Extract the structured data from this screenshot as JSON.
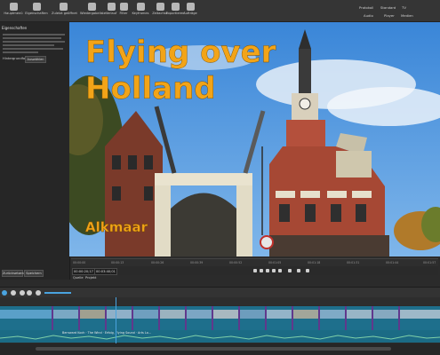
{
  "toolbar": {
    "items": [
      {
        "label": "Hauptmenü",
        "icon": "menu-icon"
      },
      {
        "label": "Eigenschaften",
        "icon": "properties-icon"
      },
      {
        "label": "Zuletzt geöffnet",
        "icon": "recent-icon"
      },
      {
        "label": "Wiedergabeliste",
        "icon": "playlist-icon"
      },
      {
        "label": "Verlauf",
        "icon": "history-icon"
      },
      {
        "label": "Filter",
        "icon": "filter-icon"
      },
      {
        "label": "Keyframes",
        "icon": "keyframes-icon"
      },
      {
        "label": "Zeitachse",
        "icon": "timeline-icon"
      },
      {
        "label": "Exportieren",
        "icon": "export-icon"
      },
      {
        "label": "Aufträge",
        "icon": "jobs-icon"
      }
    ],
    "right_top": [
      "Protokoll",
      "Standard",
      "TV"
    ],
    "right_bottom": [
      "Audio",
      "Player",
      "Medien"
    ]
  },
  "left_panel": {
    "heading": "Eigenschaften",
    "field_label": "Hintergrundfarbe",
    "field_button": "Auswählen",
    "bottom_buttons": [
      "Zurücksetzen",
      "Speichern"
    ]
  },
  "preview": {
    "title_line1": "Flying over",
    "title_line2": "Holland",
    "subtitle": "Alkmaar"
  },
  "player": {
    "ruler_ticks": [
      "00:00:00",
      "00:00:13",
      "00:00:26",
      "00:00:39",
      "00:00:52",
      "00:01:05",
      "00:01:18",
      "00:01:31",
      "00:01:44",
      "00:01:57"
    ],
    "timecode_current": "00:00:20;17",
    "timecode_total": "00:03:40;01",
    "tabs": [
      "Quelle",
      "Projekt"
    ]
  },
  "timeline": {
    "audio_clip_label": "Bernward Koch · The Wind · Erfolg, Flying Sound · Arts Lo..."
  },
  "colors": {
    "title_accent": "#f2a418",
    "track_video": "#1e6f8c",
    "track_audio": "#1b6b85",
    "playhead": "#4aa3df"
  }
}
